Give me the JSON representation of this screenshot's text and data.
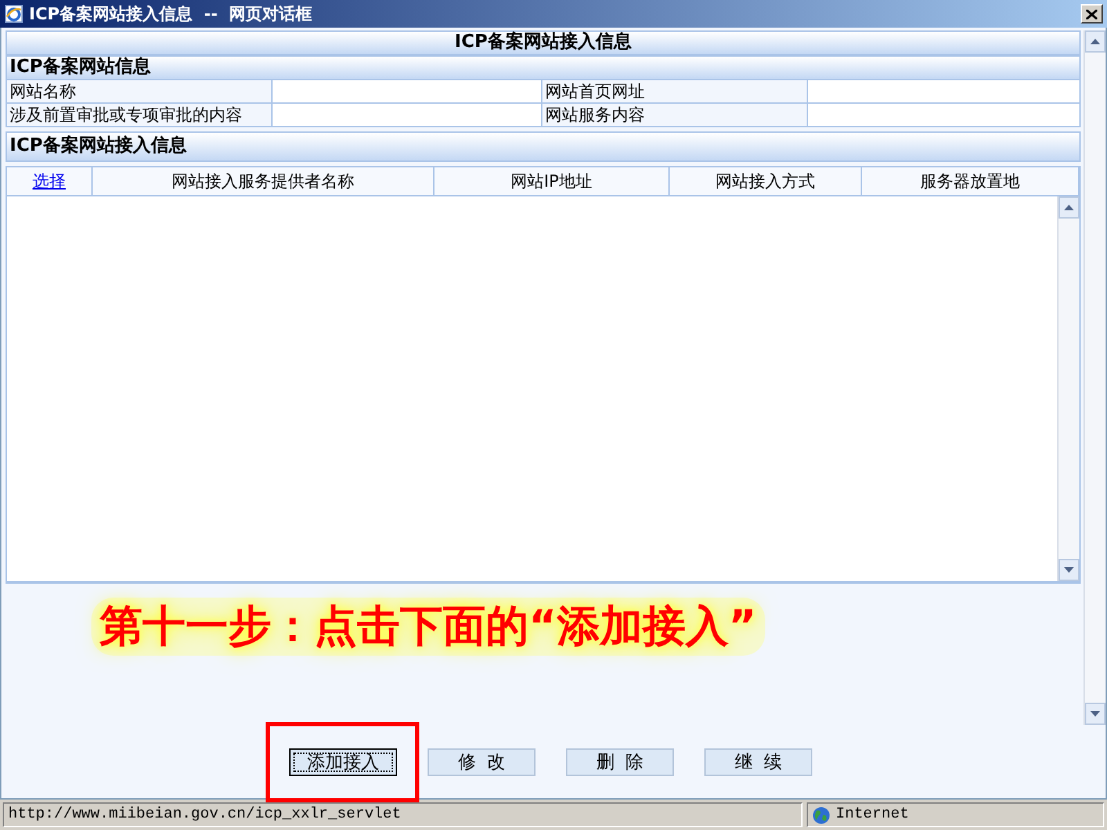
{
  "window": {
    "title": "ICP备案网站接入信息  --  网页对话框"
  },
  "page_title": "ICP备案网站接入信息",
  "site_info": {
    "heading": "ICP备案网站信息",
    "fields": [
      {
        "label": "网站名称"
      },
      {
        "label": "网站首页网址"
      },
      {
        "label": "涉及前置审批或专项审批的内容"
      },
      {
        "label": "网站服务内容"
      }
    ]
  },
  "access_info": {
    "heading": "ICP备案网站接入信息",
    "columns": [
      {
        "label": "选择",
        "kind": "link"
      },
      {
        "label": "网站接入服务提供者名称",
        "kind": "text"
      },
      {
        "label": "网站IP地址",
        "kind": "text"
      },
      {
        "label": "网站接入方式",
        "kind": "text"
      },
      {
        "label": "服务器放置地",
        "kind": "text"
      }
    ]
  },
  "annotation": {
    "text": "第十一步：点击下面的“添加接入”"
  },
  "buttons": [
    {
      "label": "添加接入",
      "focused": true,
      "highlighted": true
    },
    {
      "label": "修  改",
      "focused": false,
      "highlighted": false
    },
    {
      "label": "删  除",
      "focused": false,
      "highlighted": false
    },
    {
      "label": "继  续",
      "focused": false,
      "highlighted": false
    }
  ],
  "status_bar": {
    "url": "http://www.miibeian.gov.cn/icp_xxlr_servlet",
    "zone": "Internet"
  }
}
